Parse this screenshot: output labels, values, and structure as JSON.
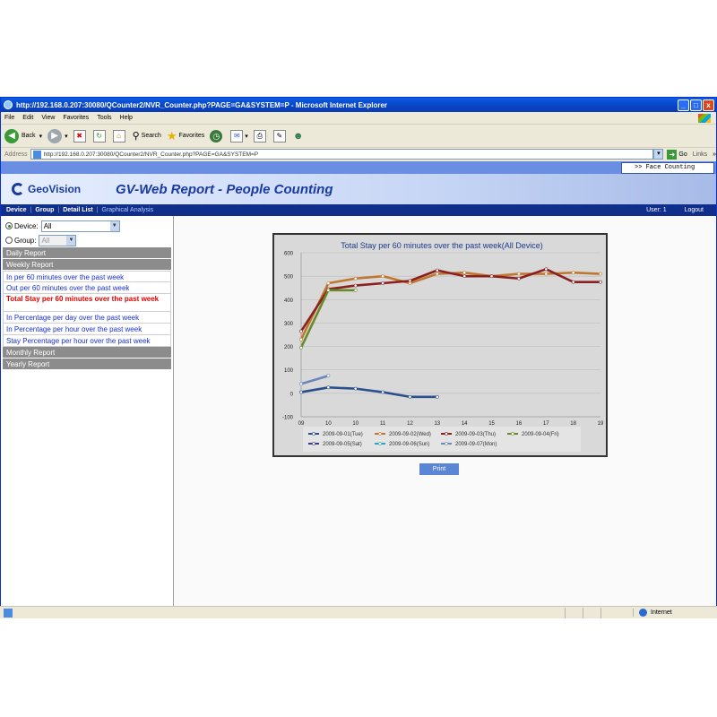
{
  "window": {
    "title": "http://192.168.0.207:30080/QCounter2/NVR_Counter.php?PAGE=GA&SYSTEM=P - Microsoft Internet Explorer",
    "buttons": [
      "_",
      "□",
      "x"
    ]
  },
  "menu": [
    "File",
    "Edit",
    "View",
    "Favorites",
    "Tools",
    "Help"
  ],
  "toolbar": {
    "back": "Back",
    "search": "Search",
    "favorites": "Favorites"
  },
  "address": {
    "label": "Address",
    "url": "http://192.168.0.207:30080/QCounter2/NVR_Counter.php?PAGE=GA&SYSTEM=P",
    "go": "Go",
    "links": "Links"
  },
  "top_link": ">> Face Counting",
  "header": {
    "logo": "GeoVision",
    "title": "GV-Web Report - People Counting"
  },
  "nav": {
    "items": [
      "Device",
      "Group",
      "Detail List",
      "Graphical Analysis"
    ],
    "user": "User: 1",
    "logout": "Logout"
  },
  "sidebar": {
    "device_label": "Device:",
    "device_value": "All",
    "group_label": "Group:",
    "group_value": "All",
    "daily": "Daily Report",
    "weekly": "Weekly Report",
    "weekly_links": [
      "In per 60 minutes over the past week",
      "Out per 60 minutes over the past week",
      "Total Stay per 60 minutes over the past week",
      "In Percentage per day over the past week",
      "In Percentage per hour over the past week",
      "Stay Percentage per hour over the past week"
    ],
    "monthly": "Monthly Report",
    "yearly": "Yearly Report"
  },
  "print_label": "Print",
  "status": {
    "zone": "Internet"
  },
  "chart_data": {
    "type": "line",
    "title": "Total Stay per 60 minutes over the past week(All Device)",
    "x": [
      "09",
      "10",
      "10",
      "11",
      "12",
      "13",
      "14",
      "15",
      "16",
      "17",
      "18",
      "19"
    ],
    "ylim": [
      -100,
      600
    ],
    "yticks": [
      -100,
      0,
      100,
      200,
      300,
      400,
      500,
      600
    ],
    "grid": true,
    "legend_position": "bottom",
    "series": [
      {
        "name": "2009-09-01(Tue)",
        "color": "#2b4f8e",
        "values": [
          5,
          25,
          20,
          5,
          -15,
          -15,
          null,
          null,
          null,
          null,
          null,
          null
        ]
      },
      {
        "name": "2009-09-02(Wed)",
        "color": "#c07830",
        "values": [
          230,
          470,
          490,
          500,
          470,
          510,
          515,
          500,
          510,
          510,
          515,
          510
        ]
      },
      {
        "name": "2009-09-03(Thu)",
        "color": "#8a2020",
        "values": [
          265,
          445,
          460,
          470,
          480,
          525,
          500,
          500,
          490,
          530,
          475,
          475
        ]
      },
      {
        "name": "2009-09-04(Fri)",
        "color": "#6a8a2a",
        "values": [
          195,
          440,
          440,
          null,
          null,
          null,
          null,
          null,
          null,
          null,
          null,
          null
        ]
      },
      {
        "name": "2009-09-05(Sat)",
        "color": "#3a3a8a",
        "values": []
      },
      {
        "name": "2009-09-06(Sun)",
        "color": "#30a0c0",
        "values": []
      },
      {
        "name": "2009-09-07(Mon)",
        "color": "#6a88b8",
        "values": [
          40,
          75,
          null,
          null,
          null,
          null,
          null,
          null,
          null,
          null,
          null,
          null
        ]
      }
    ]
  }
}
